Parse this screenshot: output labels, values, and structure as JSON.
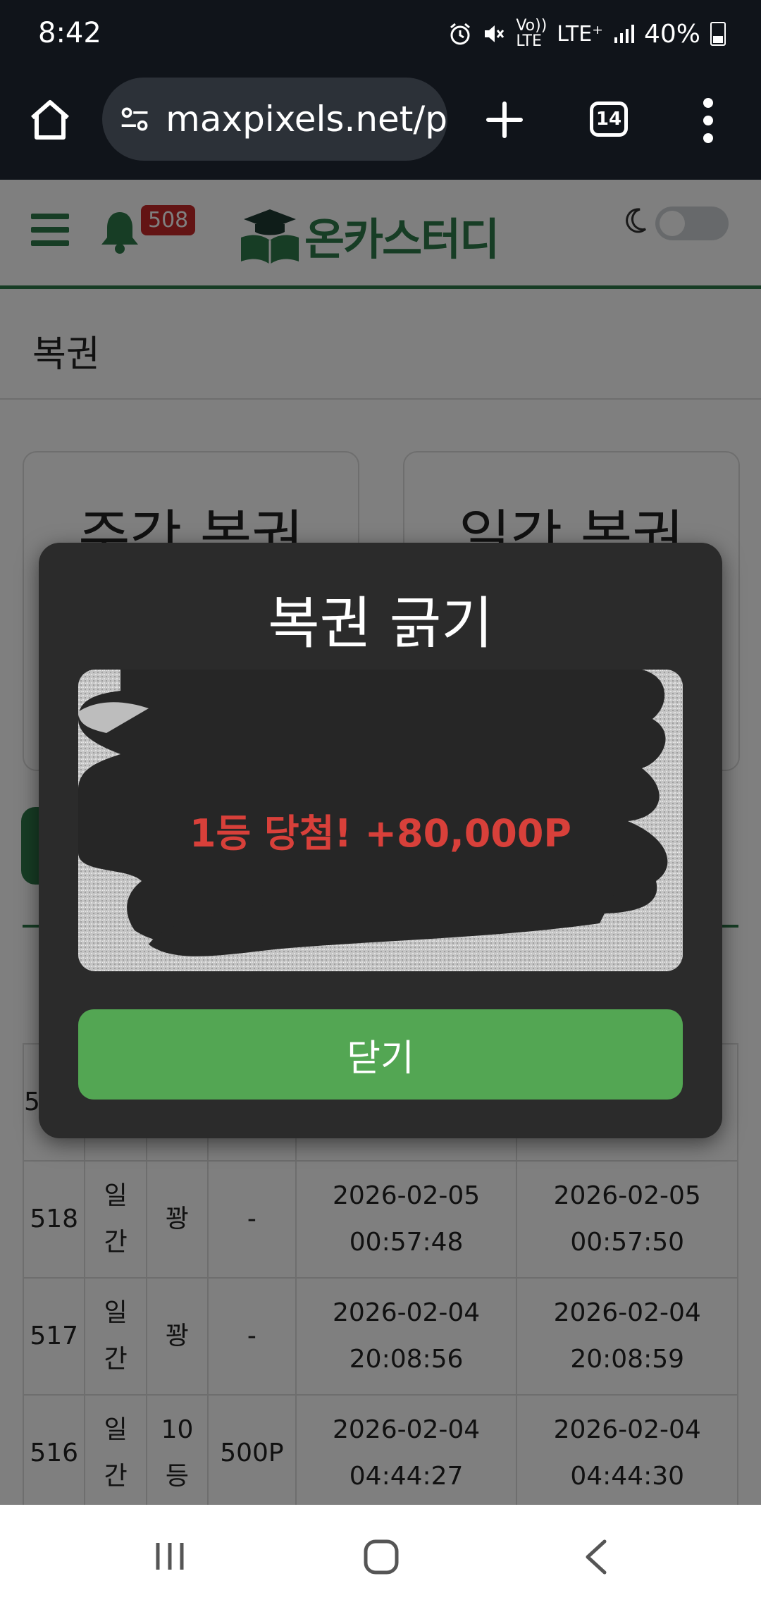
{
  "status_bar": {
    "time": "8:42",
    "network_top": "Vo))",
    "network_bottom": "LTE",
    "lte_label": "LTE⁺",
    "battery": "40%"
  },
  "browser": {
    "url": "maxpixels.net/p",
    "tab_count": "14"
  },
  "site": {
    "notification_count": "508",
    "logo_text": "온카스터디",
    "section_title": "복권",
    "cards": [
      {
        "title": "주간 복권"
      },
      {
        "title": "일간 복권"
      }
    ],
    "table": {
      "partial_row": {
        "id": "5"
      },
      "rows": [
        {
          "id": "518",
          "type": "일간",
          "rank": "꽝",
          "prize": "-",
          "issued": "2026-02-05 00:57:48",
          "scratched": "2026-02-05 00:57:50"
        },
        {
          "id": "517",
          "type": "일간",
          "rank": "꽝",
          "prize": "-",
          "issued": "2026-02-04 20:08:56",
          "scratched": "2026-02-04 20:08:59"
        },
        {
          "id": "516",
          "type": "일간",
          "rank": "10등",
          "prize": "500P",
          "issued": "2026-02-04 04:44:27",
          "scratched": "2026-02-04 04:44:30"
        }
      ]
    }
  },
  "modal": {
    "title": "복권 긁기",
    "result": "1등 당첨! +80,000P",
    "close_label": "닫기"
  },
  "colors": {
    "brand_green": "#2f7a4a",
    "button_green": "#53a653",
    "prize_red": "#d8403a",
    "badge_red": "#c62828"
  }
}
